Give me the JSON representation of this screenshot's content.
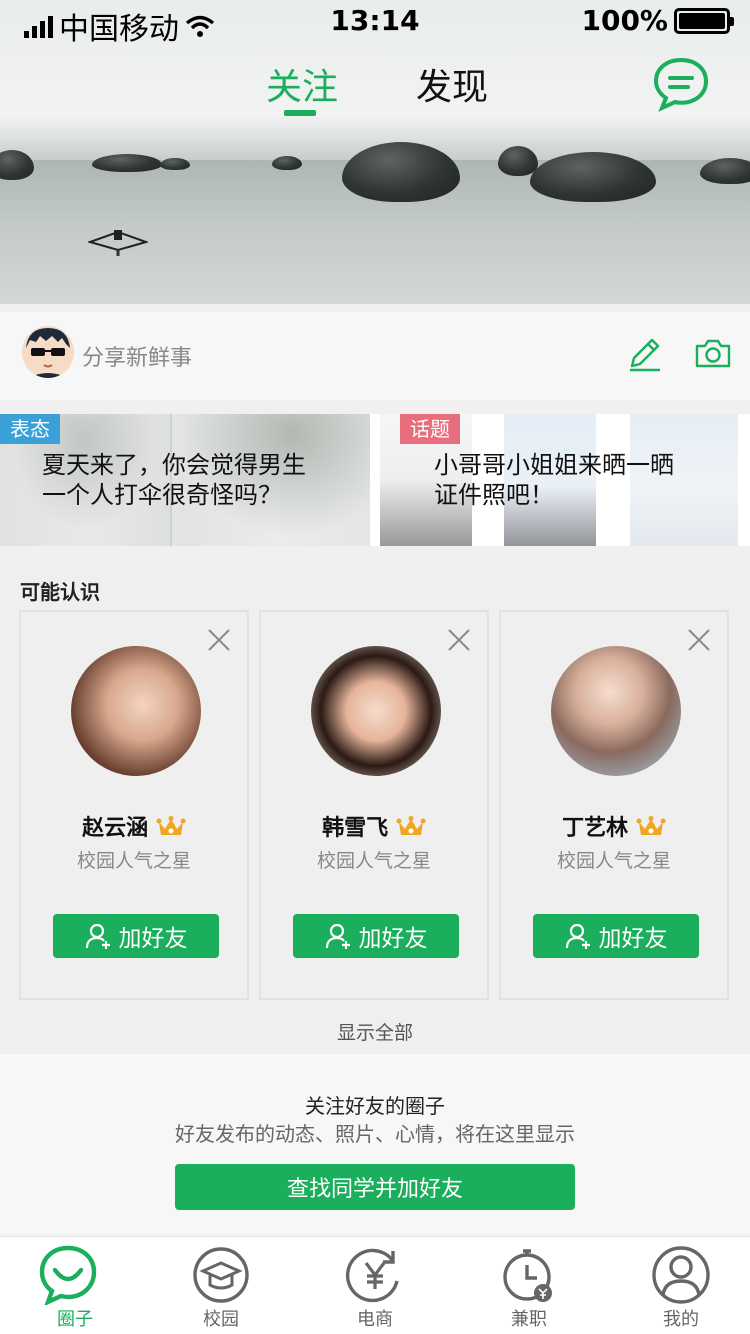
{
  "status_bar": {
    "carrier": "中国移动",
    "time": "13:14",
    "battery": "100%"
  },
  "top_tabs": [
    {
      "label": "关注",
      "active": true
    },
    {
      "label": "发现",
      "active": false
    }
  ],
  "post_bar": {
    "placeholder": "分享新鲜事"
  },
  "topics": [
    {
      "tag": "表态",
      "tag_color": "#3aa0d8",
      "title_line1": "夏天来了，你会觉得男生",
      "title_line2": "一个人打伞很奇怪吗？"
    },
    {
      "tag": "话题",
      "tag_color": "#e86e7d",
      "title_line1": "小哥哥小姐姐来晒一晒",
      "title_line2": "证件照吧！"
    }
  ],
  "people": {
    "title": "可能认识",
    "cards": [
      {
        "name": "赵云涵",
        "subtitle": "校园人气之星",
        "button": "加好友"
      },
      {
        "name": "韩雪飞",
        "subtitle": "校园人气之星",
        "button": "加好友"
      },
      {
        "name": "丁艺林",
        "subtitle": "校园人气之星",
        "button": "加好友"
      }
    ],
    "show_all": "显示全部"
  },
  "follow": {
    "title": "关注好友的圈子",
    "description": "好友发布的动态、照片、心情，将在这里显示",
    "button": "查找同学并加好友"
  },
  "tab_bar": [
    {
      "label": "圈子",
      "icon": "circle-smile-icon",
      "active": true
    },
    {
      "label": "校园",
      "icon": "graduation-cap-icon",
      "active": false
    },
    {
      "label": "电商",
      "icon": "yen-icon",
      "active": false
    },
    {
      "label": "兼职",
      "icon": "stopwatch-icon",
      "active": false
    },
    {
      "label": "我的",
      "icon": "user-icon",
      "active": false
    }
  ],
  "colors": {
    "brand": "#1aae5d",
    "tag_blue": "#3aa0d8",
    "tag_pink": "#e86e7d",
    "crown": "#f0a623"
  }
}
